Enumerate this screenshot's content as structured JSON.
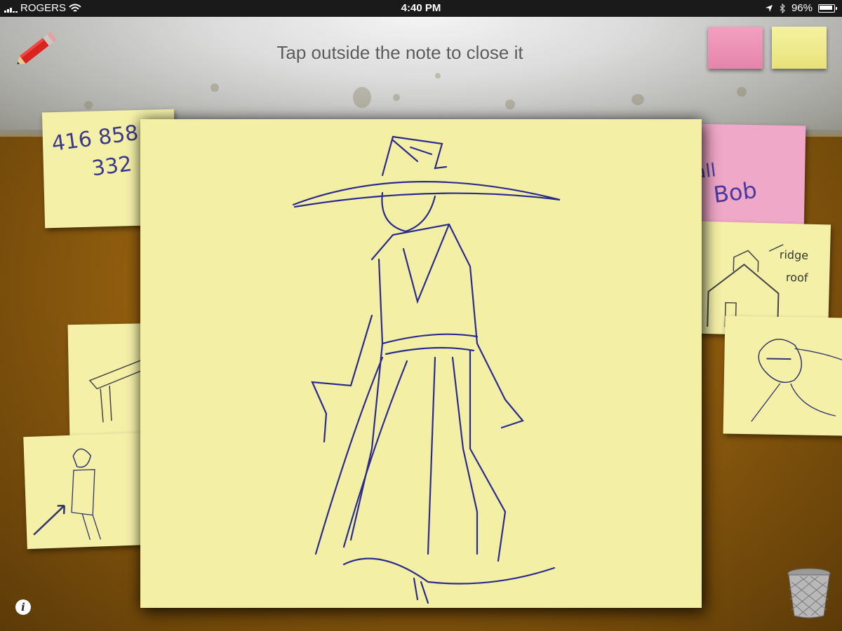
{
  "status_bar": {
    "carrier": "ROGERS",
    "time": "4:40 PM",
    "battery": "96%"
  },
  "toolbar": {
    "hint": "Tap outside the note to close it",
    "pen_tool_icon": "pencil-icon",
    "color_options": [
      {
        "name": "pink",
        "color": "#ee95b9"
      },
      {
        "name": "yellow",
        "color": "#f0ec8e"
      }
    ]
  },
  "notes": [
    {
      "id": "phone-note",
      "text_line1": "416 858",
      "text_line2": "332"
    },
    {
      "id": "call-bob-note",
      "text_line1": "all",
      "text_line2": "Bob"
    },
    {
      "id": "house-note",
      "text_line1": "ridge",
      "text_line2": "roof"
    },
    {
      "id": "table-note"
    },
    {
      "id": "figure-note"
    },
    {
      "id": "portrait-note"
    }
  ],
  "open_note": {
    "ink_color": "#2b2a8f",
    "paper_color": "#f3f0a6"
  },
  "footer": {
    "info_label": "i",
    "trash_icon": "trash-icon"
  }
}
